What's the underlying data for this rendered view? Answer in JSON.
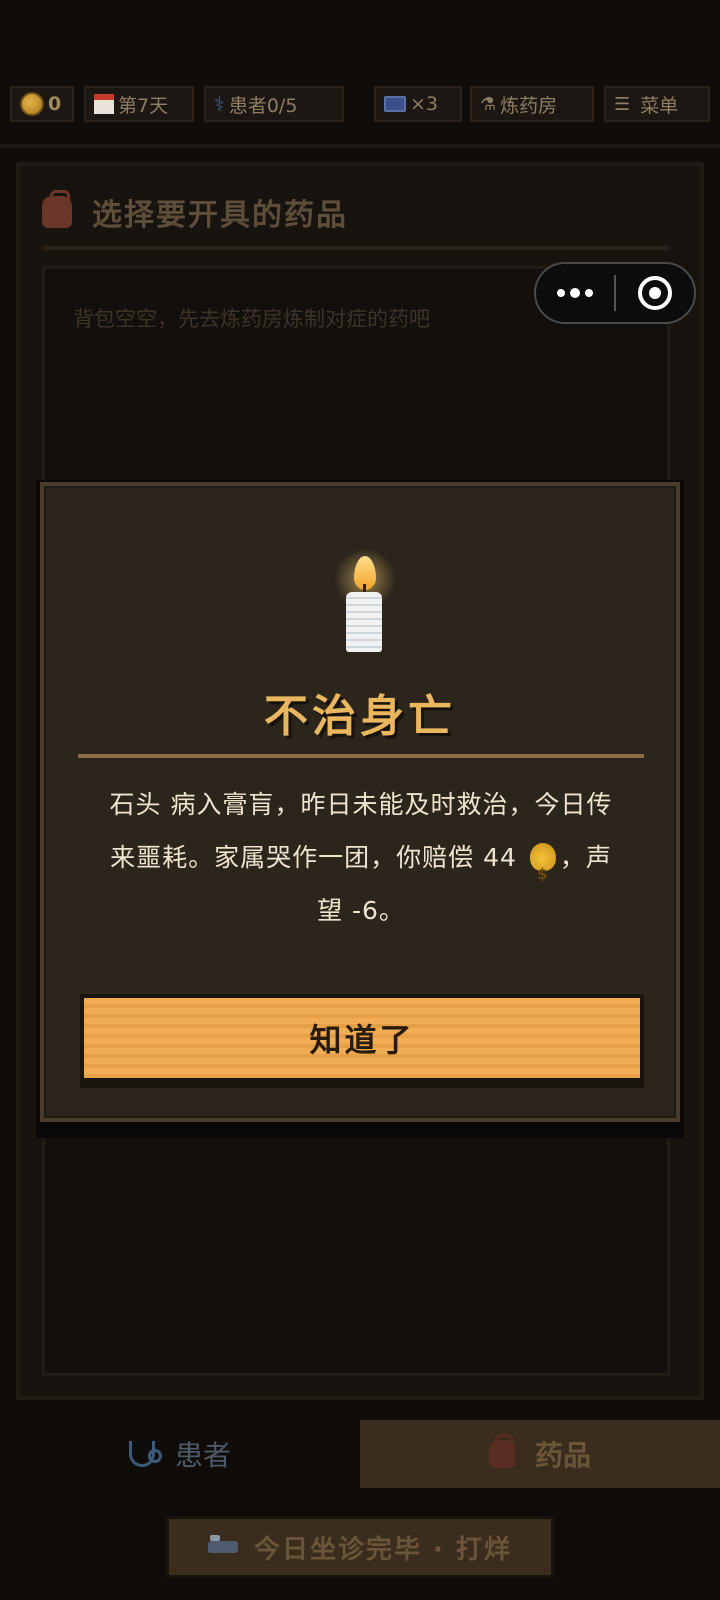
{
  "status_bar": {
    "coins": "0",
    "day": "第7天",
    "patients": "患者0/5",
    "ad_multiplier": "×3",
    "alchemy_room": "炼药房",
    "menu": "菜单"
  },
  "panel": {
    "title": "选择要开具的药品",
    "empty_hint": "背包空空，先去炼药房炼制对症的药吧"
  },
  "modal": {
    "title": "不治身亡",
    "line1": "石头 病入膏肓，昨日未能及时救治，今日传",
    "line2_before": "来噩耗。家属哭作一团，你赔偿 44",
    "line2_after": "，声",
    "line3": "望 -6。",
    "confirm_label": "知道了"
  },
  "tabs": {
    "patients_label": "患者",
    "medicine_label": "药品",
    "active": "medicine"
  },
  "end_day_label": "今日坐诊完毕 · 打烊",
  "icons": {
    "coin": "coin-icon",
    "calendar": "calendar-icon",
    "stethoscope": "stethoscope-icon",
    "tv": "tv-icon",
    "flask": "flask-icon",
    "menu": "hamburger-icon",
    "bag": "backpack-icon",
    "candle": "candle-icon",
    "money_bag": "money-bag-icon",
    "bed": "bed-icon"
  },
  "colors": {
    "accent": "#eab75e",
    "button": "#f0ad55",
    "background": "#0f0c09"
  }
}
